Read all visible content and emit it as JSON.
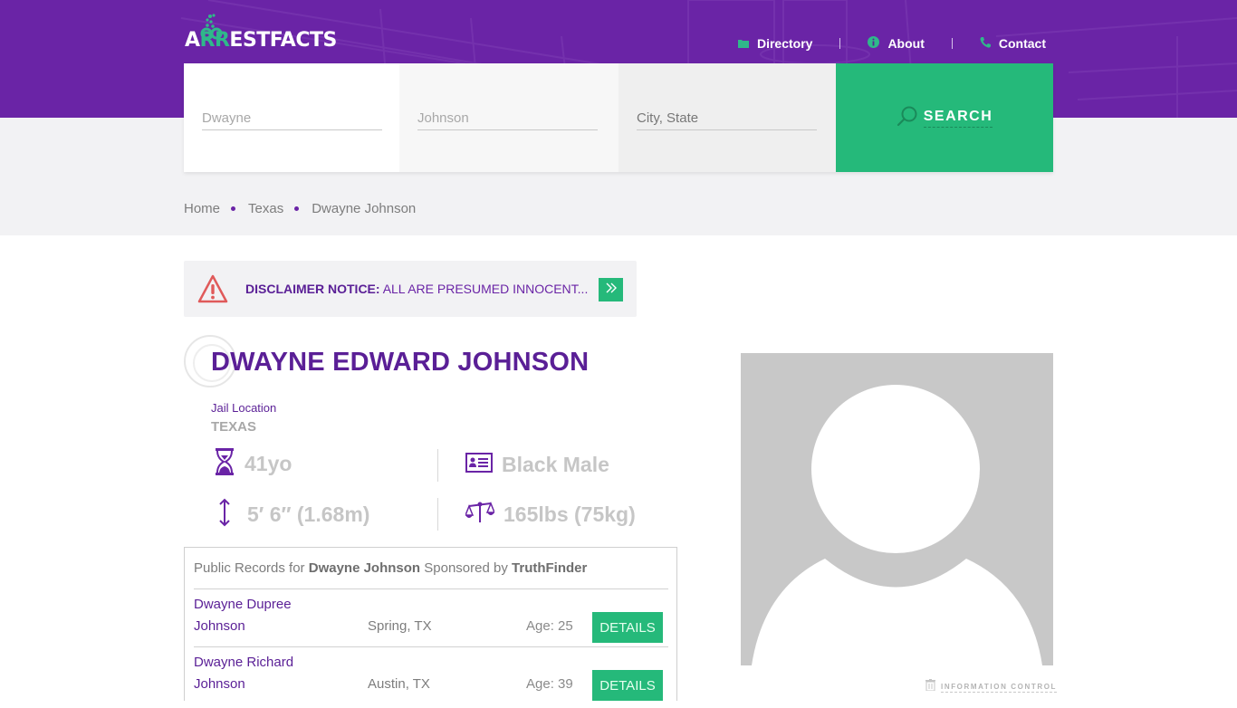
{
  "brand": {
    "logo_prefix": "A",
    "logo_highlight": "RR",
    "logo_suffix": "ESTFACTS",
    "primary_color": "#6a24a6",
    "accent_color": "#25b97a"
  },
  "nav": {
    "items": [
      {
        "label": "Directory",
        "icon": "folder-icon"
      },
      {
        "label": "About",
        "icon": "info-icon"
      },
      {
        "label": "Contact",
        "icon": "phone-icon"
      }
    ]
  },
  "search": {
    "first_name_placeholder": "Dwayne",
    "last_name_placeholder": "Johnson",
    "location_placeholder": "City, State",
    "button_label": "SEARCH"
  },
  "breadcrumb": [
    "Home",
    "Texas",
    "Dwayne Johnson"
  ],
  "disclaimer": {
    "title": "DISCLAIMER NOTICE:",
    "text": "ALL ARE PRESUMED INNOCENT...",
    "more_icon": "double-chevron-right-icon"
  },
  "profile": {
    "name": "DWAYNE EDWARD JOHNSON",
    "jail_location_label": "Jail Location",
    "jail_location": "TEXAS",
    "age": "41yo",
    "race_gender": "Black Male",
    "height": "5′ 6″ (1.68m)",
    "weight": "165lbs (75kg)"
  },
  "records": {
    "prefix": "Public Records for",
    "name": "Dwayne Johnson",
    "middle": "Sponsored by",
    "sponsor": "TruthFinder",
    "rows": [
      {
        "name_line1": "Dwayne Dupree",
        "name_line2": "Johnson",
        "location": "Spring, TX",
        "age": "Age: 25",
        "button": "DETAILS"
      },
      {
        "name_line1": "Dwayne Richard",
        "name_line2": "Johnson",
        "location": "Austin, TX",
        "age": "Age: 39",
        "button": "DETAILS"
      }
    ]
  },
  "photo": {
    "alt": "default profile silhouette"
  },
  "info_control": {
    "label": "INFORMATION CONTROL"
  }
}
